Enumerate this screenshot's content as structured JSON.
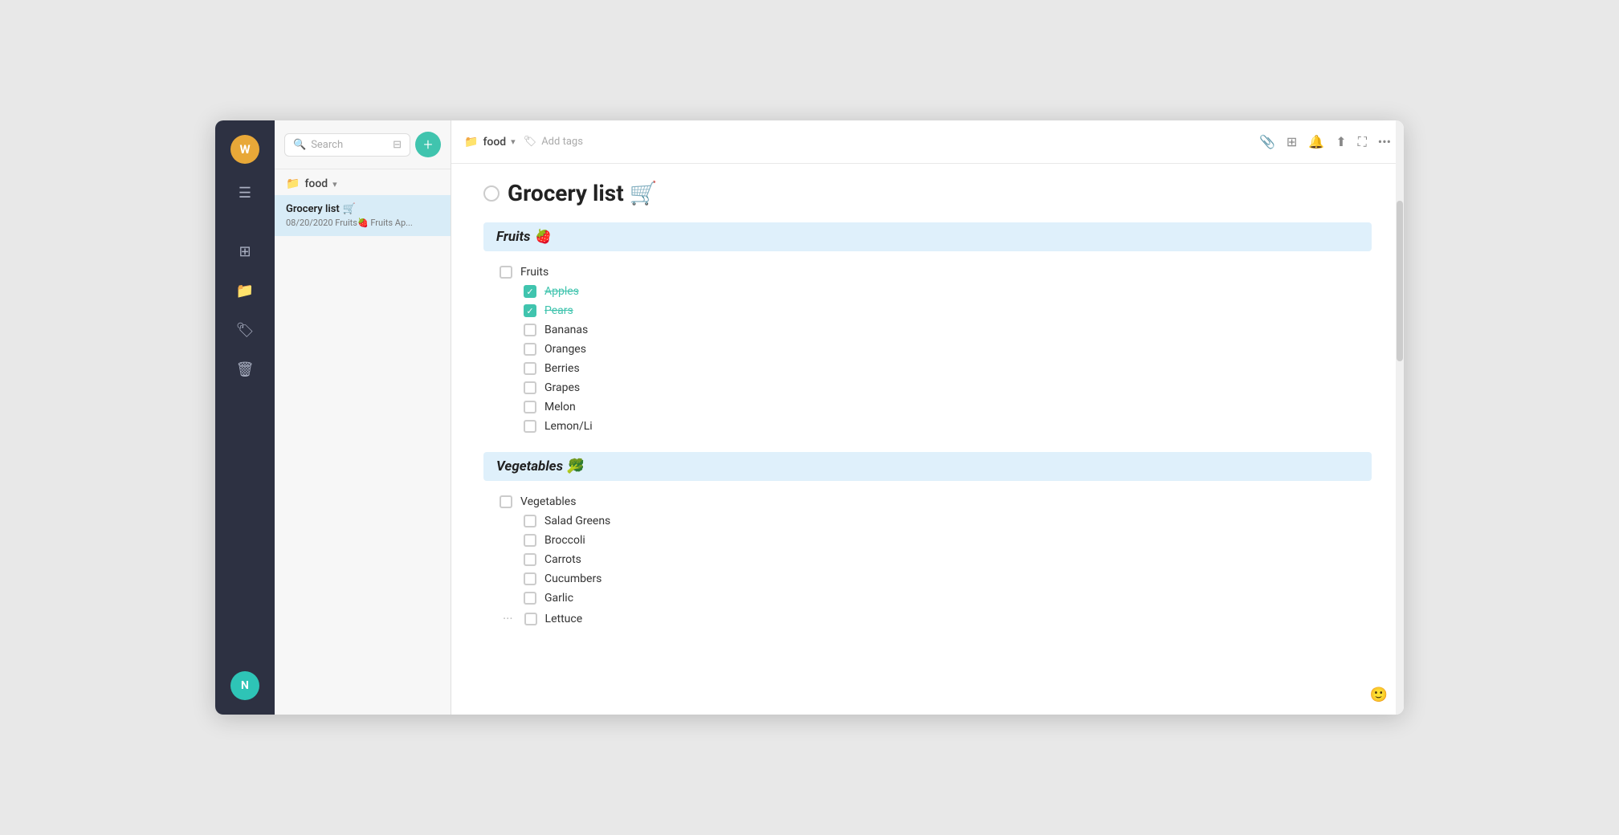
{
  "window": {
    "title": "Grocery list"
  },
  "dark_sidebar": {
    "avatar_letter": "W",
    "bottom_avatar_letter": "N",
    "nav_icons": [
      "grid",
      "folder",
      "tag",
      "trash"
    ]
  },
  "notes_sidebar": {
    "search_placeholder": "Search",
    "add_button_label": "+",
    "folder_name": "food",
    "note_item": {
      "title": "Grocery list",
      "emoji": "🛒",
      "meta": "08/20/2020  Fruits🍓  Fruits Ap..."
    }
  },
  "top_bar": {
    "folder_name": "food",
    "add_tags_label": "Add tags",
    "actions": [
      "attachment",
      "grid",
      "bell",
      "share",
      "expand",
      "more"
    ]
  },
  "note": {
    "title": "Grocery list",
    "title_emoji": "🛒",
    "sections": [
      {
        "id": "fruits",
        "label": "Fruits",
        "emoji": "🍓",
        "group_label": "Fruits",
        "group_checked": false,
        "items": [
          {
            "label": "Apples",
            "checked": true
          },
          {
            "label": "Pears",
            "checked": true
          },
          {
            "label": "Bananas",
            "checked": false
          },
          {
            "label": "Oranges",
            "checked": false
          },
          {
            "label": "Berries",
            "checked": false
          },
          {
            "label": "Grapes",
            "checked": false
          },
          {
            "label": "Melon",
            "checked": false
          },
          {
            "label": "Lemon/Li",
            "checked": false
          }
        ]
      },
      {
        "id": "vegetables",
        "label": "Vegetables",
        "emoji": "🥦",
        "group_label": "Vegetables",
        "group_checked": false,
        "items": [
          {
            "label": "Salad Greens",
            "checked": false
          },
          {
            "label": "Broccoli",
            "checked": false
          },
          {
            "label": "Carrots",
            "checked": false
          },
          {
            "label": "Cucumbers",
            "checked": false
          },
          {
            "label": "Garlic",
            "checked": false
          },
          {
            "label": "Lettuce",
            "checked": false
          }
        ]
      }
    ]
  }
}
